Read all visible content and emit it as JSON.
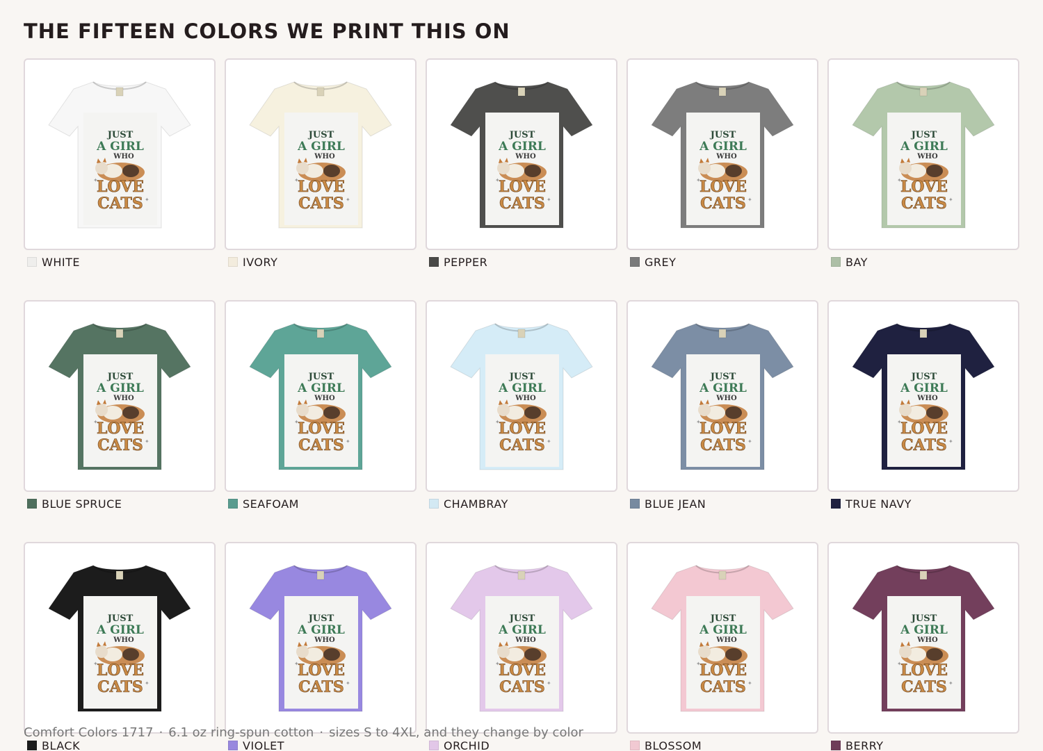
{
  "title": "THE FIFTEEN COLORS WE PRINT THIS ON",
  "design": {
    "line1": "JUST",
    "line2": "A GIRL",
    "line3": "WHO",
    "line4": "LOVE",
    "line5": "CATS"
  },
  "colors": [
    {
      "name": "WHITE",
      "hex": "#f7f7f7",
      "chip": "#efeeec"
    },
    {
      "name": "IVORY",
      "hex": "#f6f1df",
      "chip": "#f3ecdd"
    },
    {
      "name": "PEPPER",
      "hex": "#4f4f4d",
      "chip": "#4a4a48"
    },
    {
      "name": "GREY",
      "hex": "#7d7d7d",
      "chip": "#7a7a7a"
    },
    {
      "name": "BAY",
      "hex": "#b3c8ab",
      "chip": "#adbfa6"
    },
    {
      "name": "BLUE SPRUCE",
      "hex": "#557462",
      "chip": "#4f6f5d"
    },
    {
      "name": "SEAFOAM",
      "hex": "#5ea597",
      "chip": "#5a9c8f"
    },
    {
      "name": "CHAMBRAY",
      "hex": "#d5ecf7",
      "chip": "#d3e9f3"
    },
    {
      "name": "BLUE JEAN",
      "hex": "#7c8ea5",
      "chip": "#778aa0"
    },
    {
      "name": "TRUE NAVY",
      "hex": "#1f2140",
      "chip": "#1f2140"
    },
    {
      "name": "BLACK",
      "hex": "#1c1c1c",
      "chip": "#1c1c1c"
    },
    {
      "name": "VIOLET",
      "hex": "#9888e0",
      "chip": "#9888de"
    },
    {
      "name": "ORCHID",
      "hex": "#e3c8ea",
      "chip": "#e2c7e8"
    },
    {
      "name": "BLOSSOM",
      "hex": "#f3c8d2",
      "chip": "#f1c9d2"
    },
    {
      "name": "BERRY",
      "hex": "#733f5c",
      "chip": "#6f3c59"
    }
  ],
  "footer": {
    "part1": "Comfort Colors 1717",
    "part2": "6.1 oz ring-spun cotton",
    "part3": "sizes S to 4XL, and they change by color",
    "separator": "·"
  }
}
